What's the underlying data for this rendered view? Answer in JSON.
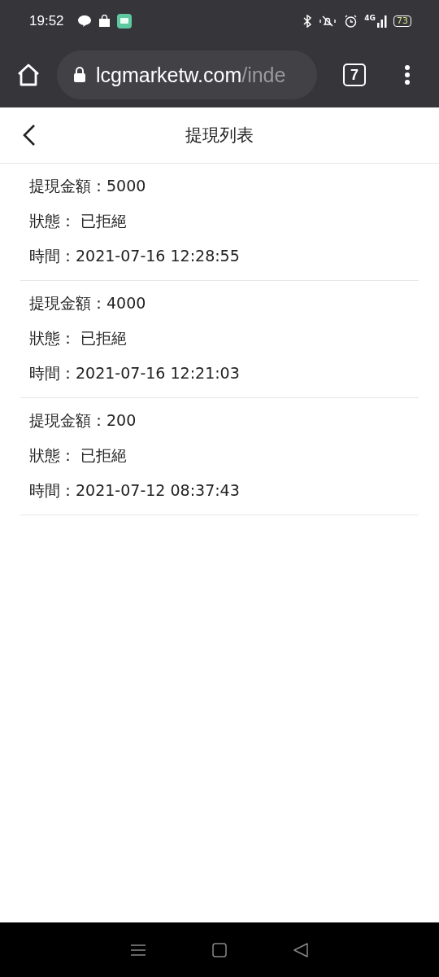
{
  "status_bar": {
    "time": "19:52",
    "network": "4G",
    "battery": "73"
  },
  "browser": {
    "url_host": "lcgmarketw.com",
    "url_path": "/inde",
    "tab_count": "7"
  },
  "header": {
    "title": "提現列表"
  },
  "records": [
    {
      "amount_label": "提現金額：",
      "amount": "5000",
      "status_label": "狀態：",
      "status": "已拒絕",
      "time_label": "時間：",
      "time": "2021-07-16 12:28:55"
    },
    {
      "amount_label": "提現金額：",
      "amount": "4000",
      "status_label": "狀態：",
      "status": "已拒絕",
      "time_label": "時間：",
      "time": "2021-07-16 12:21:03"
    },
    {
      "amount_label": "提現金額：",
      "amount": "200",
      "status_label": "狀態：",
      "status": "已拒絕",
      "time_label": "時間：",
      "time": "2021-07-12 08:37:43"
    }
  ]
}
